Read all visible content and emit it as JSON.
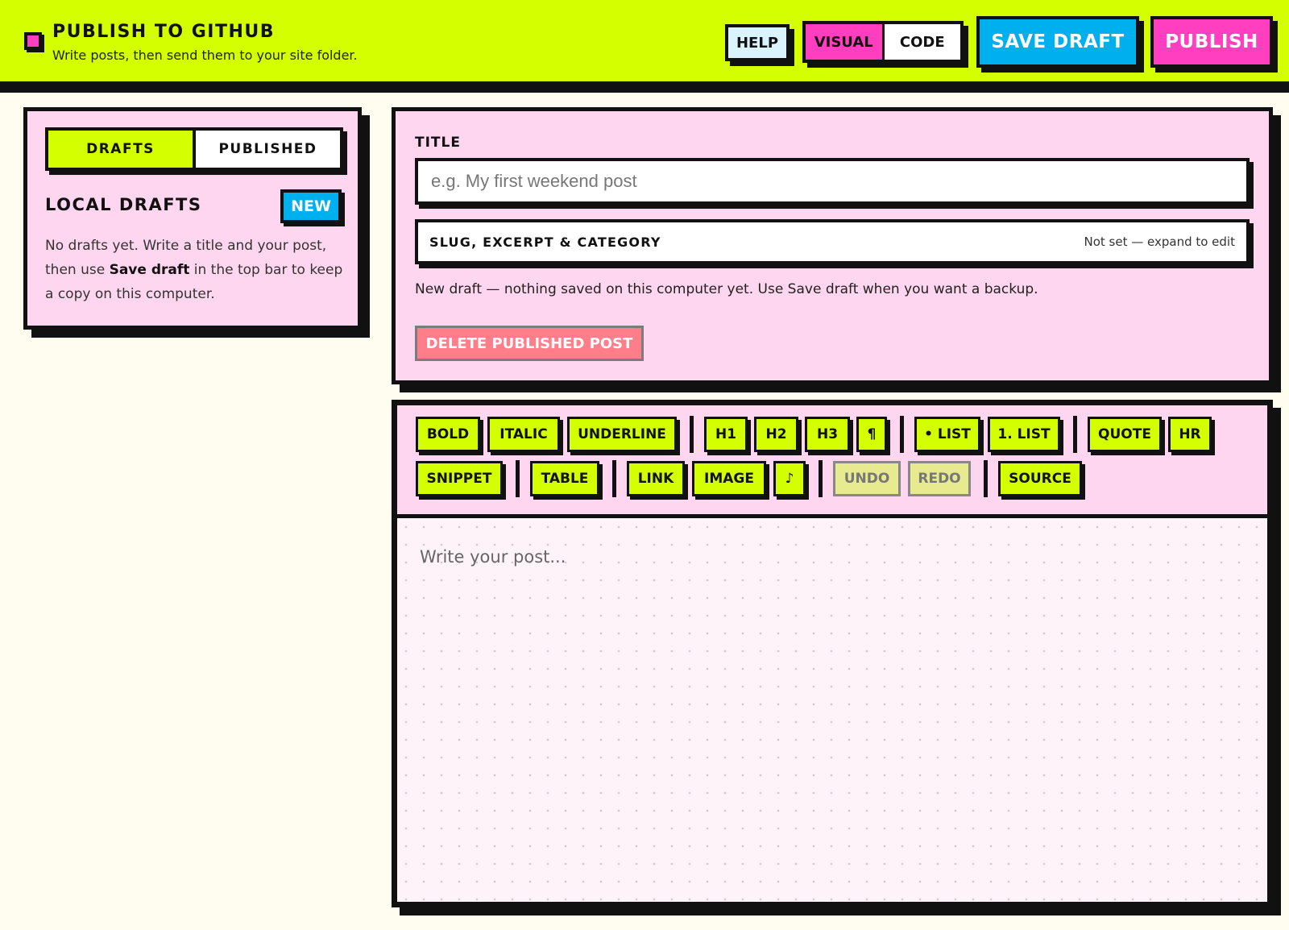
{
  "app": {
    "title": "PUBLISH TO GITHUB",
    "subtitle": "Write posts, then send them to your site folder."
  },
  "topbar": {
    "help_label": "HELP",
    "mode_options": [
      "VISUAL",
      "CODE"
    ],
    "mode_selected": "VISUAL",
    "save_draft_label": "SAVE DRAFT",
    "publish_label": "PUBLISH"
  },
  "sidebar": {
    "tabs": [
      {
        "label": "DRAFTS",
        "active": true
      },
      {
        "label": "PUBLISHED",
        "active": false
      }
    ],
    "section_title": "LOCAL DRAFTS",
    "new_label": "NEW",
    "empty_before": "No drafts yet. Write a title and your post, then use ",
    "empty_bold": "Save draft",
    "empty_after": " in the top bar to keep a copy on this computer."
  },
  "post": {
    "title_label": "TITLE",
    "title_placeholder": "e.g. My first weekend post",
    "title_value": "",
    "meta_label": "SLUG, EXCERPT & CATEGORY",
    "meta_status": "Not set — expand to edit",
    "status_text": "New draft — nothing saved on this computer yet. Use Save draft when you want a backup.",
    "delete_label": "DELETE PUBLISHED POST"
  },
  "toolbar": {
    "buttons": [
      {
        "label": "BOLD"
      },
      {
        "label": "ITALIC"
      },
      {
        "label": "UNDERLINE"
      },
      {
        "label": "H1"
      },
      {
        "label": "H2"
      },
      {
        "label": "H3"
      },
      {
        "label": "¶"
      },
      {
        "label": "• LIST"
      },
      {
        "label": "1. LIST"
      },
      {
        "label": "QUOTE"
      },
      {
        "label": "HR"
      },
      {
        "label": "SNIPPET"
      },
      {
        "label": "TABLE"
      },
      {
        "label": "LINK"
      },
      {
        "label": "IMAGE"
      },
      {
        "label": "♪"
      },
      {
        "label": "UNDO",
        "disabled": true
      },
      {
        "label": "REDO",
        "disabled": true
      },
      {
        "label": "SOURCE"
      }
    ]
  },
  "editor": {
    "placeholder": "Write your post..."
  },
  "colors": {
    "lime": "#d4ff00",
    "pink": "#ff3fbf",
    "cyan": "#00b0ee",
    "panel_pink": "#ffd6ef",
    "background": "#fffdf0",
    "danger": "#ff7a84"
  }
}
